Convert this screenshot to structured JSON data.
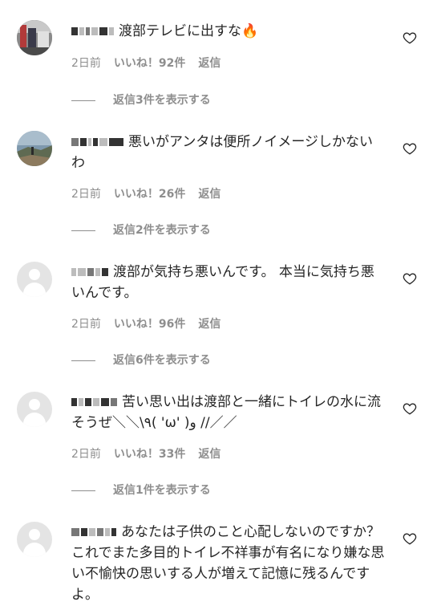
{
  "comments": [
    {
      "text": "渡部テレビに出すな🔥",
      "time": "2日前",
      "likes": "いいね！92件",
      "reply": "返信",
      "view_replies": "返信3件を表示する"
    },
    {
      "text": "悪いがアンタは便所ノイメージしかないわ",
      "time": "2日前",
      "likes": "いいね！26件",
      "reply": "返信",
      "view_replies": "返信2件を表示する"
    },
    {
      "text": "渡部が気持ち悪いんです。 本当に気持ち悪いんです。",
      "time": "2日前",
      "likes": "いいね！96件",
      "reply": "返信",
      "view_replies": "返信6件を表示する"
    },
    {
      "text": "苦い思い出は渡部と一緒にトイレの水に流そうぜ＼＼\\٩( 'ω' )و //／／",
      "time": "2日前",
      "likes": "いいね！33件",
      "reply": "返信",
      "view_replies": "返信1件を表示する"
    },
    {
      "text": "あなたは子供のこと心配しないのですか？これでまた多目的トイレ不祥事が有名になり嫌な思い不愉快の思いする人が増えて記憶に残るんですよ。"
    }
  ],
  "icons": {
    "like": "heart-outline-icon",
    "avatar_default": "default-user-icon"
  },
  "colors": {
    "meta_text": "#8e8e8e",
    "body_text": "#262626"
  }
}
